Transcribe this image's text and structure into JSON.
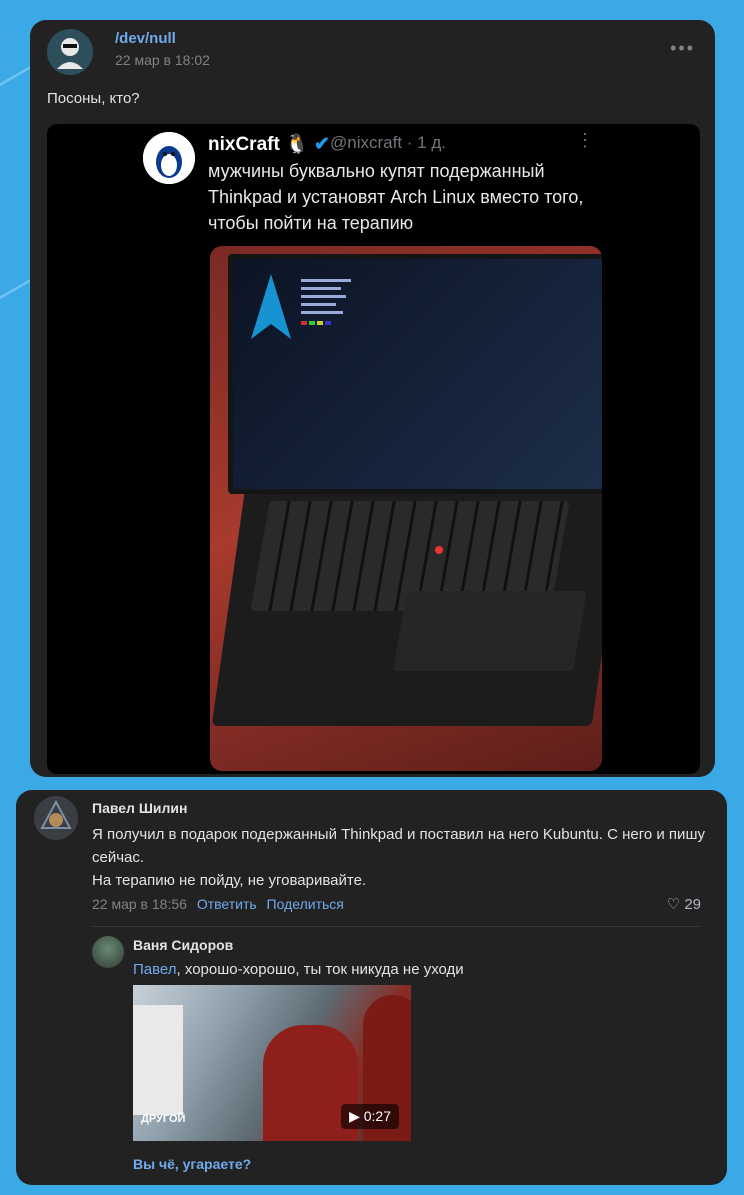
{
  "post": {
    "author": "/dev/null",
    "date": "22 мар в 18:02",
    "text": "Посоны, кто?",
    "tweet": {
      "name": "nixCraft",
      "handle": "@nixcraft · 1 д.",
      "text": "мужчины буквально купят подержанный Thinkpad и установят Arch Linux вместо того, чтобы пойти на терапию"
    }
  },
  "comments": [
    {
      "author": "Павел Шилин",
      "text_line1": "Я получил в подарок подержанный Thinkpad и поставил на него Kubuntu. С него и пишу сейчас.",
      "text_line2": "На терапию не пойду, не уговаривайте.",
      "date": "22 мар в 18:56",
      "reply_label": "Ответить",
      "share_label": "Поделиться",
      "likes": "29"
    }
  ],
  "reply": {
    "author": "Ваня Сидоров",
    "mention": "Павел",
    "text": ", хорошо-хорошо, ты ток никуда не уходи",
    "video_duration": "0:27",
    "video_logo": "ДРУГОЙ",
    "more_label": "Вы чё, угараете?"
  },
  "colors": {
    "accent": "#71aaeb",
    "card": "#222222",
    "background": "#3aa9e6"
  }
}
